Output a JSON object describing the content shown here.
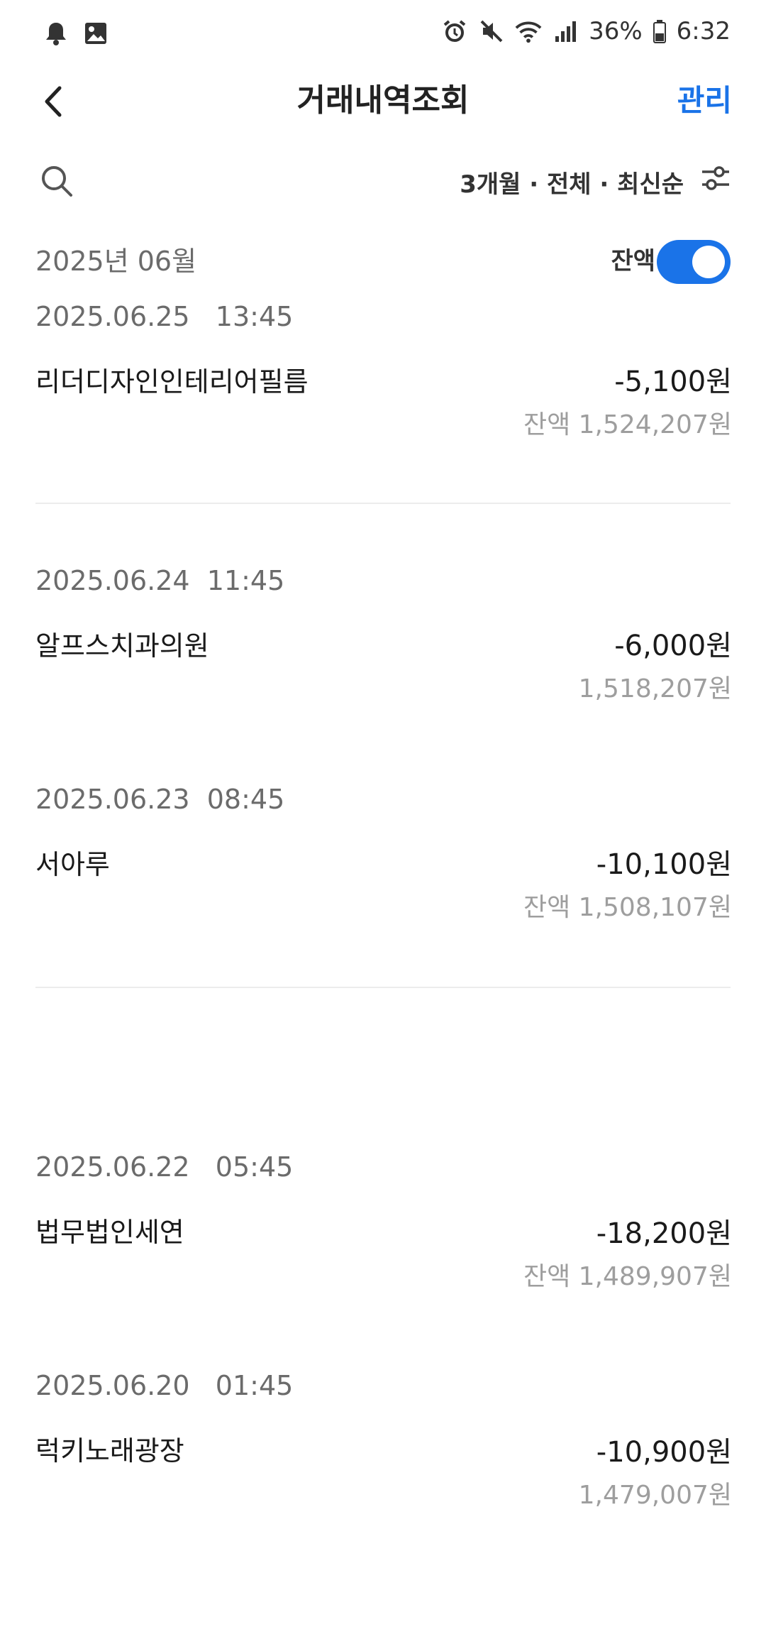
{
  "status_bar": {
    "battery": "36%",
    "time": "6:32",
    "left_icons": [
      "notification-bell-icon",
      "gallery-image-icon"
    ],
    "right_icons": [
      "alarm-icon",
      "mute-icon",
      "wifi-icon",
      "signal-icon",
      "battery-icon"
    ]
  },
  "header": {
    "title": "거래내역조회",
    "manage_label": "관리"
  },
  "filter": {
    "summary": "3개월 · 전체 · 최신순"
  },
  "month": {
    "label": "2025년 06월",
    "balance_toggle_label": "잔액",
    "balance_toggle_on": true
  },
  "transactions": [
    {
      "date": "2025.06.25   13:45",
      "name": "리더디자인인테리어필름",
      "amount": "-5,100원",
      "balance": "잔액 1,524,207원"
    },
    {
      "date": "2025.06.24  11:45",
      "name": "알프스치과의원",
      "amount": "-6,000원",
      "balance": "1,518,207원"
    },
    {
      "date": "2025.06.23  08:45",
      "name": "서아루",
      "amount": "-10,100원",
      "balance": "잔액 1,508,107원"
    },
    {
      "date": "2025.06.22   05:45",
      "name": "법무법인세연",
      "amount": "-18,200원",
      "balance": "잔액 1,489,907원"
    },
    {
      "date": "2025.06.20   01:45",
      "name": "럭키노래광장",
      "amount": "-10,900원",
      "balance": "1,479,007원"
    }
  ],
  "colors": {
    "accent": "#1a73e8",
    "muted_text": "#9e9e9e",
    "date_text": "#6b6b6b"
  }
}
